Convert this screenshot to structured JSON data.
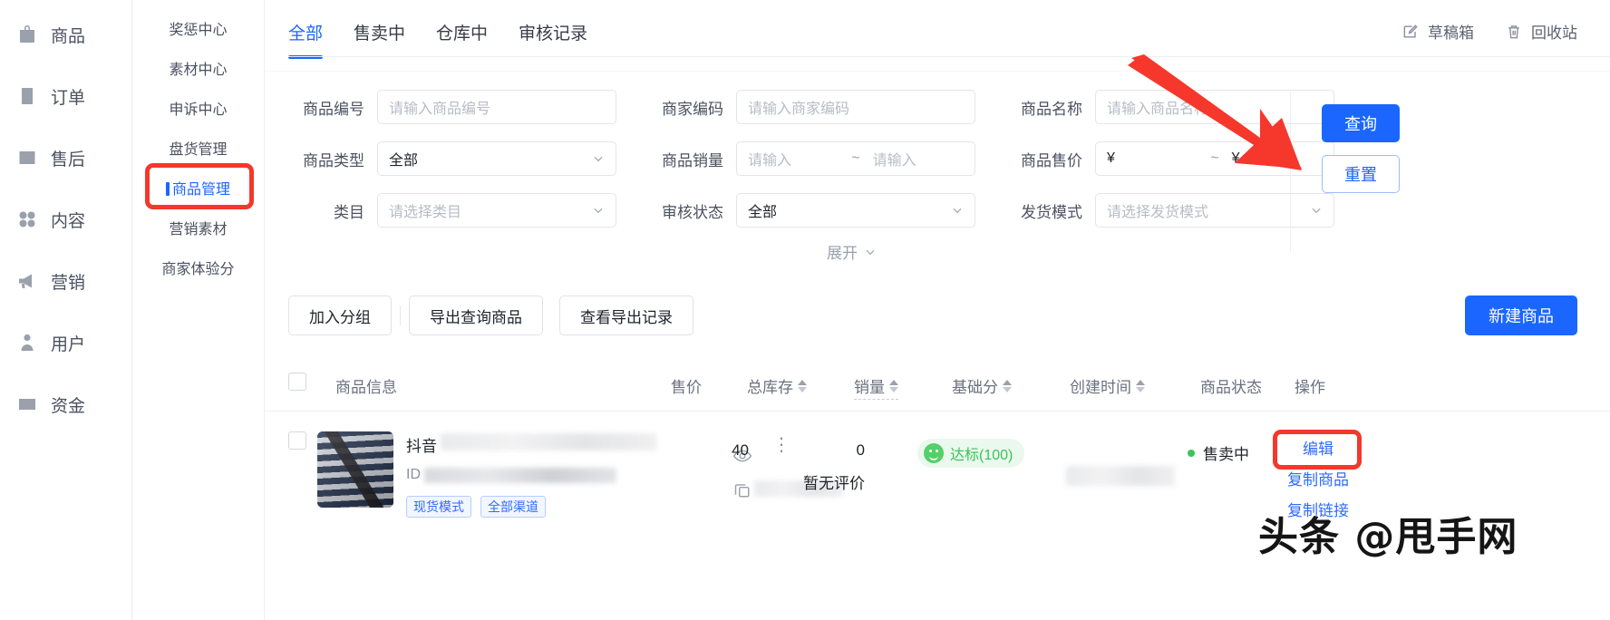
{
  "nav1": {
    "items": [
      {
        "label": "商品",
        "icon": "bag-icon"
      },
      {
        "label": "订单",
        "icon": "clipboard-icon"
      },
      {
        "label": "售后",
        "icon": "box-minus-icon"
      },
      {
        "label": "内容",
        "icon": "grid-dots-icon"
      },
      {
        "label": "营销",
        "icon": "megaphone-icon"
      },
      {
        "label": "用户",
        "icon": "user-icon"
      },
      {
        "label": "资金",
        "icon": "card-icon"
      }
    ]
  },
  "nav2": {
    "items": [
      {
        "label": "奖惩中心",
        "active": false
      },
      {
        "label": "素材中心",
        "active": false
      },
      {
        "label": "申诉中心",
        "active": false
      },
      {
        "label": "盘货管理",
        "active": false
      },
      {
        "label": "商品管理",
        "active": true
      },
      {
        "label": "营销素材",
        "active": false
      },
      {
        "label": "商家体验分",
        "active": false
      }
    ]
  },
  "tabs": [
    {
      "label": "全部",
      "active": true
    },
    {
      "label": "售卖中",
      "active": false
    },
    {
      "label": "仓库中",
      "active": false
    },
    {
      "label": "审核记录",
      "active": false
    }
  ],
  "tab_actions": [
    {
      "label": "草稿箱",
      "icon": "draft-edit-icon"
    },
    {
      "label": "回收站",
      "icon": "trash-icon"
    }
  ],
  "filters": {
    "rows": [
      [
        {
          "label": "商品编号",
          "type": "input",
          "placeholder": "请输入商品编号",
          "value": ""
        },
        {
          "label": "商家编码",
          "type": "input",
          "placeholder": "请输入商家编码",
          "value": ""
        },
        {
          "label": "商品名称",
          "type": "input",
          "placeholder": "请输入商品名称",
          "value": ""
        }
      ],
      [
        {
          "label": "商品类型",
          "type": "select",
          "placeholder": "",
          "value": "全部"
        },
        {
          "label": "商品销量",
          "type": "range",
          "from_placeholder": "请输入",
          "to_placeholder": "请输入",
          "separator": "~"
        },
        {
          "label": "商品售价",
          "type": "range-currency",
          "prefix": "¥",
          "suffix": "¥",
          "separator": "~"
        }
      ],
      [
        {
          "label": "类目",
          "type": "select",
          "placeholder": "请选择类目",
          "value": ""
        },
        {
          "label": "审核状态",
          "type": "select",
          "placeholder": "",
          "value": "全部"
        },
        {
          "label": "发货模式",
          "type": "select",
          "placeholder": "请选择发货模式",
          "value": ""
        }
      ]
    ],
    "expand_label": "展开",
    "search_button": "查询",
    "reset_button": "重置"
  },
  "toolbar": {
    "buttons": [
      "加入分组",
      "导出查询商品",
      "查看导出记录"
    ],
    "new_product": "新建商品"
  },
  "table": {
    "columns": [
      {
        "label": "商品信息",
        "sortable": false
      },
      {
        "label": "售价",
        "sortable": false
      },
      {
        "label": "总库存",
        "sortable": true
      },
      {
        "label": "销量",
        "sortable": true
      },
      {
        "label": "基础分",
        "sortable": true
      },
      {
        "label": "创建时间",
        "sortable": true
      },
      {
        "label": "商品状态",
        "sortable": false
      },
      {
        "label": "操作",
        "sortable": false
      }
    ],
    "rows": [
      {
        "title_prefix": "抖音",
        "id_label": "ID",
        "tags": [
          "现货模式",
          "全部渠道"
        ],
        "price": "",
        "stock": "40",
        "sales": "0",
        "sales_sub": "暂无评价",
        "score_label": "达标(100)",
        "created": "",
        "status": "售卖中",
        "actions": [
          "编辑",
          "复制商品",
          "复制链接"
        ]
      }
    ]
  },
  "watermark": "头条 @甩手网",
  "colors": {
    "accent": "#1a66ff",
    "highlight": "#f5372c",
    "success": "#38c65a",
    "score_green": "#3cc35a"
  }
}
